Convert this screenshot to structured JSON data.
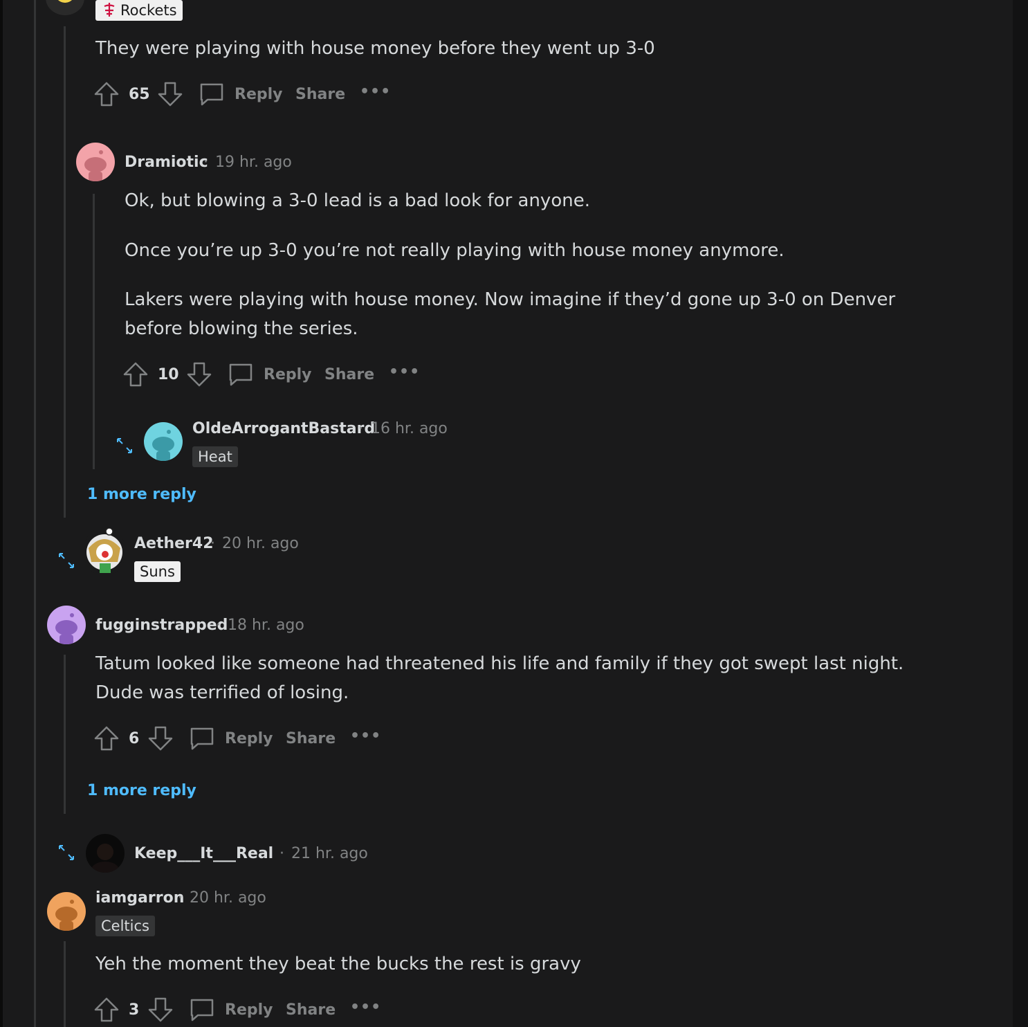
{
  "colors": {
    "background": "#1a1a1b",
    "text": "#d7dadc",
    "muted": "#818384",
    "link": "#4fbcff",
    "thread_line": "#343536"
  },
  "top_comment": {
    "flair": "Rockets",
    "body": "They were playing with house money before they went up 3-0",
    "votes": "65"
  },
  "dramiotic": {
    "username": "Dramiotic",
    "time": "19 hr. ago",
    "para1": "Ok, but blowing a 3-0 lead is a bad look for anyone.",
    "para2": "Once you’re up 3-0 you’re not really playing with house money anymore.",
    "para3_line1": "Lakers were playing with house money. Now imagine if they’d gone up 3-0 on Denver",
    "para3_line2": "before blowing the series.",
    "votes": "10"
  },
  "olde": {
    "username": "OldeArrogantBastard",
    "time": "16 hr. ago",
    "flair": "Heat"
  },
  "more_reply_1": "1 more reply",
  "aether": {
    "username": "Aether42",
    "time": "20 hr. ago",
    "flair": "Suns"
  },
  "fugg": {
    "username": "fugginstrapped",
    "time": "18 hr. ago",
    "line1": "Tatum looked like someone had threatened his life and family if they got swept last night.",
    "line2": "Dude was terrified of losing.",
    "votes": "6"
  },
  "more_reply_2": "1 more reply",
  "keep": {
    "username": "Keep___It___Real",
    "time": "21 hr. ago"
  },
  "iamgarron": {
    "username": "iamgarron",
    "time": "20 hr. ago",
    "flair": "Celtics",
    "body": "Yeh the moment they beat the bucks the rest is gravy",
    "votes": "3"
  },
  "actions": {
    "reply": "Reply",
    "share": "Share",
    "more": "•••",
    "dot": "·"
  },
  "icons": [
    "upvote-icon",
    "downvote-icon",
    "comment-icon",
    "overflow-icon",
    "expand-icon",
    "rockets-logo-icon"
  ]
}
